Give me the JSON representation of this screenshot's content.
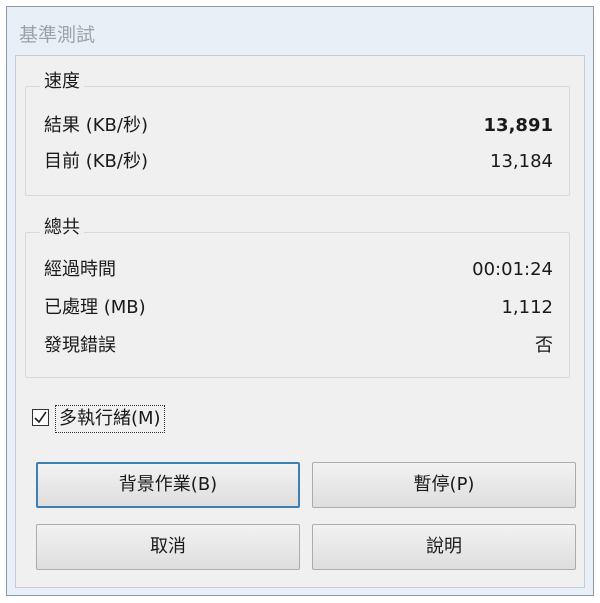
{
  "window": {
    "title": "基準測試"
  },
  "speed": {
    "legend": "速度",
    "result_label": "結果 (KB/秒)",
    "result_value": "13,891",
    "current_label": "目前 (KB/秒)",
    "current_value": "13,184"
  },
  "total": {
    "legend": "總共",
    "elapsed_label": "經過時間",
    "elapsed_value": "00:01:24",
    "processed_label": "已處理 (MB)",
    "processed_value": "1,112",
    "errors_label": "發現錯誤",
    "errors_value": "否"
  },
  "multithread": {
    "label": "多執行緒(M)",
    "checked": true
  },
  "buttons": {
    "background": "背景作業(B)",
    "pause": "暫停(P)",
    "cancel": "取消",
    "help": "說明"
  }
}
